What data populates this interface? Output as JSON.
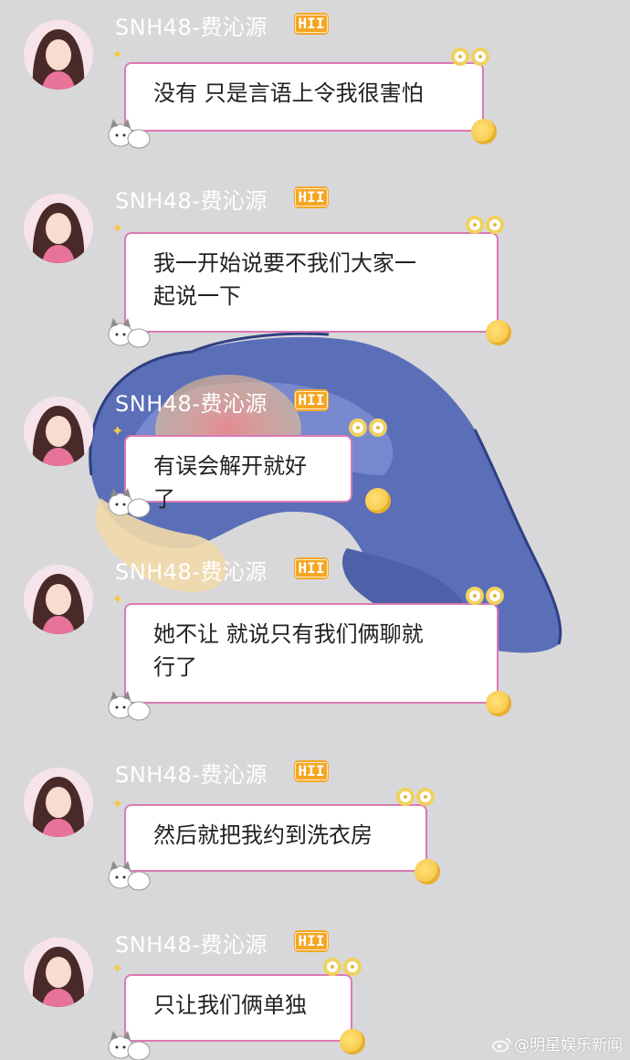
{
  "sender": {
    "name": "SNH48-费沁源",
    "badge": "HII"
  },
  "messages": [
    {
      "lines": [
        "没有 只是言语上令我很害怕"
      ]
    },
    {
      "lines": [
        "我一开始说要不我们大家一",
        "起说一下"
      ]
    },
    {
      "lines": [
        "有误会解开就好了"
      ]
    },
    {
      "lines": [
        "她不让 就说只有我们俩聊就",
        "行了"
      ]
    },
    {
      "lines": [
        "然后就把我约到洗衣房"
      ]
    },
    {
      "lines": [
        "只让我们俩单独"
      ]
    }
  ],
  "watermark": "@明星娱乐新闻",
  "colors": {
    "background": "#d8d8da",
    "bubble_border": "#d97ab4",
    "badge": "#f5a623",
    "name_text": "#ffffff"
  },
  "icons": [
    "avatar-photo",
    "sparkle-icon",
    "ring-decoration-icon",
    "yarn-ball-icon",
    "cats-sticker-icon",
    "weibo-icon"
  ]
}
